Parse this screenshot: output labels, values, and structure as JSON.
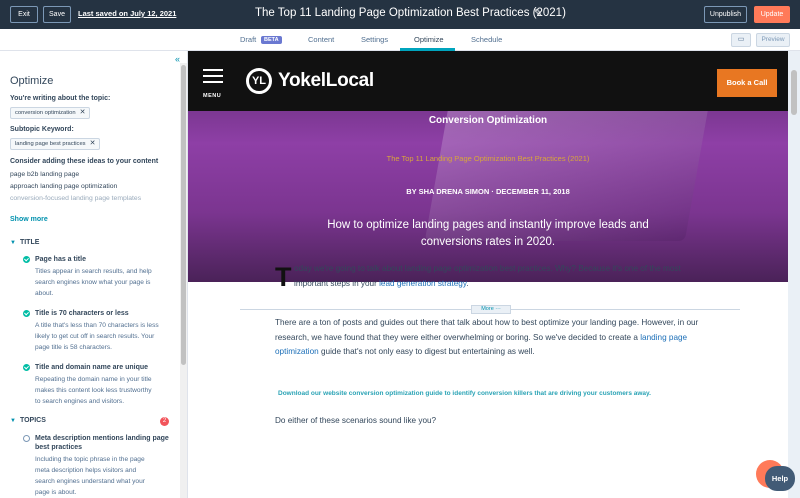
{
  "topbar": {
    "exit_label": "Exit",
    "save_label": "Save",
    "last_saved": "Last saved on July 12, 2021",
    "title": "The Top 11 Landing Page Optimization Best Practices (2021)",
    "unpublish_label": "Unpublish",
    "update_label": "Update"
  },
  "tabs": [
    {
      "label": "Draft"
    },
    {
      "label": "Content"
    },
    {
      "label": "Settings"
    },
    {
      "label": "Optimize"
    },
    {
      "label": "Schedule"
    }
  ],
  "beta_label": "BETA",
  "preview_label": "Preview",
  "sidebar": {
    "heading": "Optimize",
    "topic_label": "You're writing about the topic:",
    "topic_chip": "conversion optimization",
    "subtopic_label": "Subtopic Keyword:",
    "subtopic_chip": "landing page best practices",
    "ideas_label": "Consider adding these ideas to your content",
    "ideas": [
      "page b2b landing page",
      "approach landing page optimization",
      "conversion-focused landing page templates"
    ],
    "show_more": "Show more",
    "title_section": "TITLE",
    "title_items": [
      {
        "title": "Page has a title",
        "desc": [
          "Titles appear in search results, and help",
          "search engines know what your page is",
          "about."
        ]
      },
      {
        "title": "Title is 70 characters or less",
        "desc": [
          "A title that's less than 70 characters is less",
          "likely to get cut off in search results. Your",
          "page title is 58 characters."
        ]
      },
      {
        "title": "Title and domain name are unique",
        "desc": [
          "Repeating the domain name in your title",
          "makes this content look less trustworthy",
          "to search engines and visitors."
        ]
      }
    ],
    "topics_section": "TOPICS",
    "topics_count": "2",
    "topic_item": {
      "title": "Meta description mentions landing page best practices",
      "desc": [
        "Including the topic phrase in the page",
        "meta description helps visitors and",
        "search engines understand what your",
        "page is about."
      ]
    }
  },
  "preview": {
    "menu_label": "MENU",
    "logo_mark": "YL",
    "logo_text": "YokelLocal",
    "book_label": "Book a Call",
    "category": "Conversion Optimization",
    "subtitle": "The Top 11 Landing Page Optimization Best Practices (2021)",
    "byline": "BY SHA DRENA SIMON  ·  DECEMBER 11, 2018",
    "headline": "How to optimize landing pages and instantly improve leads and conversions rates in 2020.",
    "dropcap": "T",
    "para1_a": "oday we're going to talk about landing page optimization best practices. Why? Because it's one of the most important steps in your ",
    "para1_link": "lead generation strategy",
    "para1_b": ".",
    "more_label": "More  ···",
    "para2_a": "There are a ton of posts and guides out there that talk about how to best optimize your landing page. However, in our research, we have found that they were either overwhelming or boring. So we've decided to create a ",
    "para2_link": "landing page optimization",
    "para2_b": " guide that's not only easy to digest but entertaining as well.",
    "cta": "Download our website conversion optimization guide to identify conversion killers that are driving your customers away.",
    "para3": "Do either of these scenarios sound like you?"
  },
  "help_label": "Help"
}
